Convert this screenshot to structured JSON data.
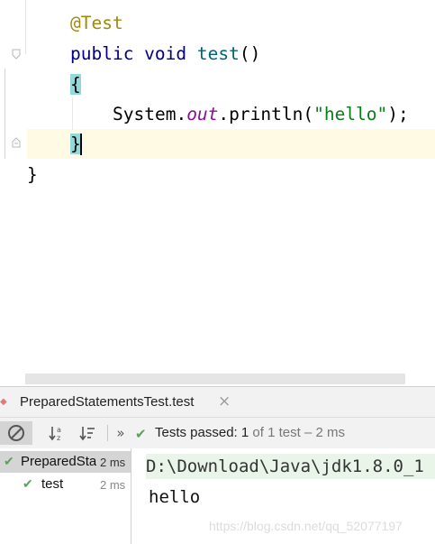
{
  "editor": {
    "lines": {
      "annotation": "@Test",
      "sig_kw": "public void",
      "sig_name": "test",
      "sig_parens": "()",
      "open_brace": "{",
      "call_prefix": "System.",
      "call_field": "out",
      "call_method": ".println(",
      "call_string": "\"hello\"",
      "call_suffix": ");",
      "close_brace": "}",
      "class_close": "}"
    }
  },
  "run_panel": {
    "tab_label": "PreparedStatementsTest.test",
    "tab_close": "×",
    "toolbar": {
      "more": "»",
      "status_main": "Tests passed:",
      "status_count": "1",
      "status_rest": "of 1 test – 2 ms"
    },
    "tree": [
      {
        "name": "PreparedStatementsTest",
        "duration": "2 ms"
      },
      {
        "name": "test",
        "duration": "2 ms"
      }
    ],
    "console": {
      "command": "D:\\Download\\Java\\jdk1.8.0_1",
      "output": "hello"
    },
    "watermark": "https://blog.csdn.net/qq_52077197"
  },
  "colors": {
    "pass_green": "#5aa25a",
    "brace_highlight": "#93d9d9",
    "caret_row": "#fffae3"
  }
}
